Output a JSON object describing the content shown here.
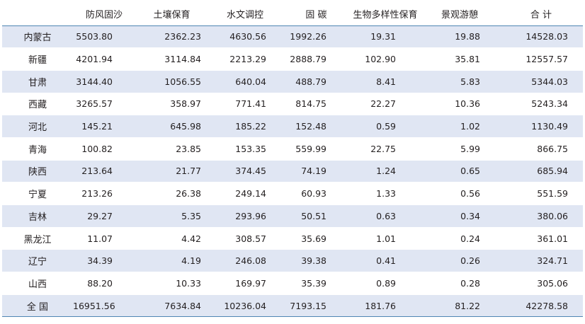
{
  "table": {
    "headers": [
      "",
      "防风固沙",
      "土壤保育",
      "水文调控",
      "固 碳",
      "生物多样性保育",
      "景观游憩",
      "合 计"
    ],
    "rows": [
      [
        "内蒙古",
        "5503.80",
        "2362.23",
        "4630.56",
        "1992.26",
        "19.31",
        "19.88",
        "14528.03"
      ],
      [
        "新疆",
        "4201.94",
        "3114.84",
        "2213.29",
        "2888.79",
        "102.90",
        "35.81",
        "12557.57"
      ],
      [
        "甘肃",
        "3144.40",
        "1056.55",
        "640.04",
        "488.79",
        "8.41",
        "5.83",
        "5344.03"
      ],
      [
        "西藏",
        "3265.57",
        "358.97",
        "771.41",
        "814.75",
        "22.27",
        "10.36",
        "5243.34"
      ],
      [
        "河北",
        "145.21",
        "645.98",
        "185.22",
        "152.48",
        "0.59",
        "1.02",
        "1130.49"
      ],
      [
        "青海",
        "100.82",
        "23.85",
        "153.35",
        "559.99",
        "22.75",
        "5.99",
        "866.75"
      ],
      [
        "陕西",
        "213.64",
        "21.77",
        "374.45",
        "74.19",
        "1.24",
        "0.65",
        "685.94"
      ],
      [
        "宁夏",
        "213.26",
        "26.38",
        "249.14",
        "60.93",
        "1.33",
        "0.56",
        "551.59"
      ],
      [
        "吉林",
        "29.27",
        "5.35",
        "293.96",
        "50.51",
        "0.63",
        "0.34",
        "380.06"
      ],
      [
        "黑龙江",
        "11.07",
        "4.42",
        "308.57",
        "35.69",
        "1.01",
        "0.24",
        "361.01"
      ],
      [
        "辽宁",
        "34.39",
        "4.19",
        "246.08",
        "39.38",
        "0.41",
        "0.26",
        "324.71"
      ],
      [
        "山西",
        "88.20",
        "10.33",
        "169.97",
        "35.39",
        "0.89",
        "0.28",
        "305.06"
      ],
      [
        "全 国",
        "16951.56",
        "7634.84",
        "10236.04",
        "7193.15",
        "181.76",
        "81.22",
        "42278.58"
      ]
    ]
  },
  "colors": {
    "shade": "#e0e6f3",
    "rule": "#4f86b4",
    "text": "#231f20"
  }
}
